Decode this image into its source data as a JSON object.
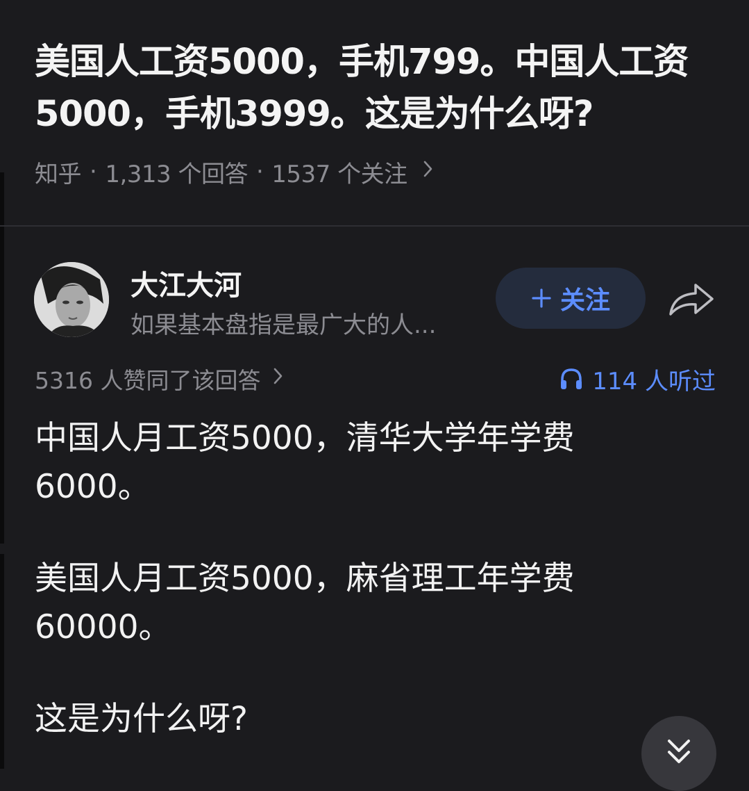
{
  "question": {
    "title": "美国人工资5000，手机799。中国人工资5000，手机3999。这是为什么呀?",
    "source": "知乎",
    "answers_count": "1,313 个回答",
    "followers_count": "1537 个关注",
    "separator": "·"
  },
  "answer": {
    "author_name": "大江大河",
    "author_bio": "如果基本盘指是最广大的人...",
    "follow_label": "关注",
    "follow_icon": "plus-icon",
    "share_icon": "share-arrow-icon",
    "upvotes_text": "5316 人赞同了该回答",
    "listened_text": "114 人听过",
    "listened_icon": "headphones-icon",
    "paragraphs": [
      "中国人月工资5000，清华大学年学费6000。",
      "美国人月工资5000，麻省理工年学费60000。",
      "这是为什么呀?"
    ]
  },
  "scroll_icon": "double-chevron-down-icon",
  "colors": {
    "background": "#1b1b1e",
    "accent": "#5c8dff",
    "muted_text": "#8c8c92",
    "follow_bg": "#242c3d"
  }
}
